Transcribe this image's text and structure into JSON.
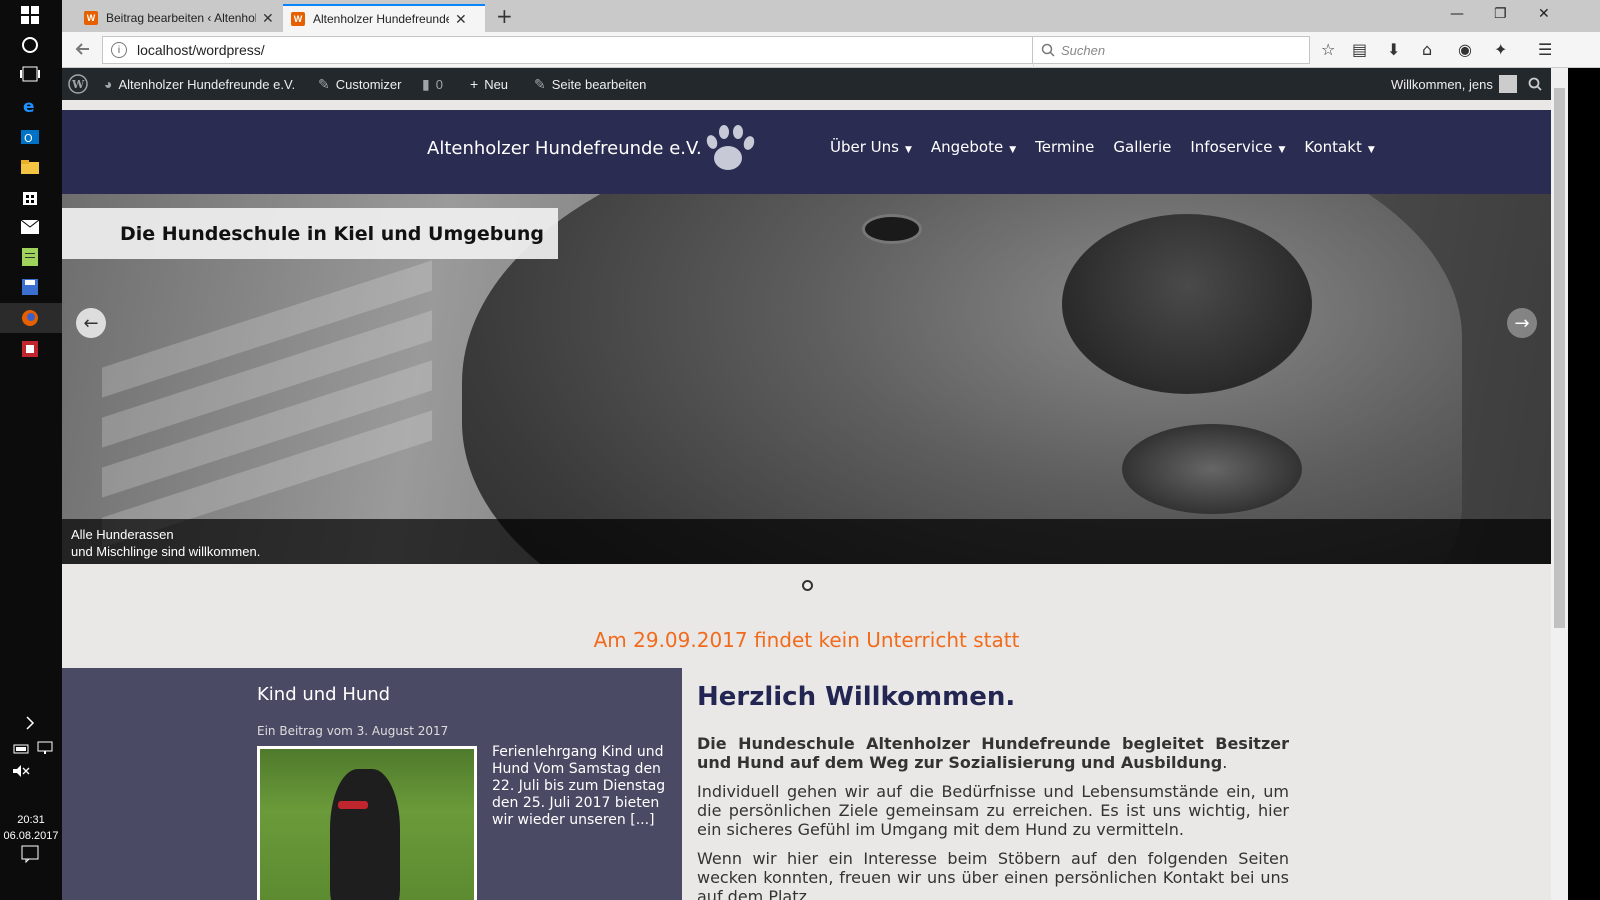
{
  "taskbar": {
    "time": "20:31",
    "date": "06.08.2017"
  },
  "browser": {
    "tabs": [
      {
        "title": "Beitrag bearbeiten ‹ Altenholzer Hundefreunde e.V.",
        "active": false
      },
      {
        "title": "Altenholzer Hundefreunde e.V.",
        "active": true
      }
    ],
    "url": "localhost/wordpress/",
    "search_placeholder": "Suchen"
  },
  "adminbar": {
    "site_name": "Altenholzer Hundefreunde e.V.",
    "customizer": "Customizer",
    "comments_count": "0",
    "new": "Neu",
    "edit_page": "Seite bearbeiten",
    "welcome": "Willkommen, jens"
  },
  "header": {
    "site_title": "Altenholzer Hundefreunde e.V.",
    "menu": [
      {
        "label": "Über Uns",
        "has_sub": true
      },
      {
        "label": "Angebote",
        "has_sub": true
      },
      {
        "label": "Termine",
        "has_sub": false
      },
      {
        "label": "Gallerie",
        "has_sub": false
      },
      {
        "label": "Infoservice",
        "has_sub": true
      },
      {
        "label": "Kontakt",
        "has_sub": true
      }
    ]
  },
  "slider": {
    "tagline": "Die Hundeschule in Kiel und Umgebung",
    "caption_line1": "Alle Hunderassen",
    "caption_line2": "und Mischlinge sind willkommen."
  },
  "notice": "Am 29.09.2017 findet kein Unterricht statt",
  "post": {
    "title": "Kind und Hund",
    "meta": "Ein Beitrag vom 3. August 2017",
    "excerpt": "Ferienlehrgang Kind und Hund Vom Samstag den 22. Juli bis zum Dienstag den 25. Juli 2017 bieten wir wieder unseren [...]"
  },
  "welcome": {
    "heading": "Herzlich Willkommen.",
    "lead_bold": "Die Hundeschule Altenholzer Hundefreunde begleitet Besitzer und Hund auf dem Weg zur Sozialisierung und Ausbildung",
    "lead_end": ".",
    "para1": "Individuell gehen wir auf die Bedürfnisse und Lebensumstände ein, um die persönlichen Ziele gemeinsam zu erreichen. Es ist uns wichtig, hier ein sicheres Gefühl im Umgang mit dem Hund zu vermitteln.",
    "para2": "Wenn wir hier ein Interesse beim Stöbern auf den folgenden Seiten wecken konnten, freuen wir uns über einen persönlichen Kontakt bei uns auf dem Platz."
  },
  "colors": {
    "header_bg": "#2a2c51",
    "notice": "#f26b1d",
    "postbox_bg": "#4a4a65",
    "heading": "#232552"
  }
}
